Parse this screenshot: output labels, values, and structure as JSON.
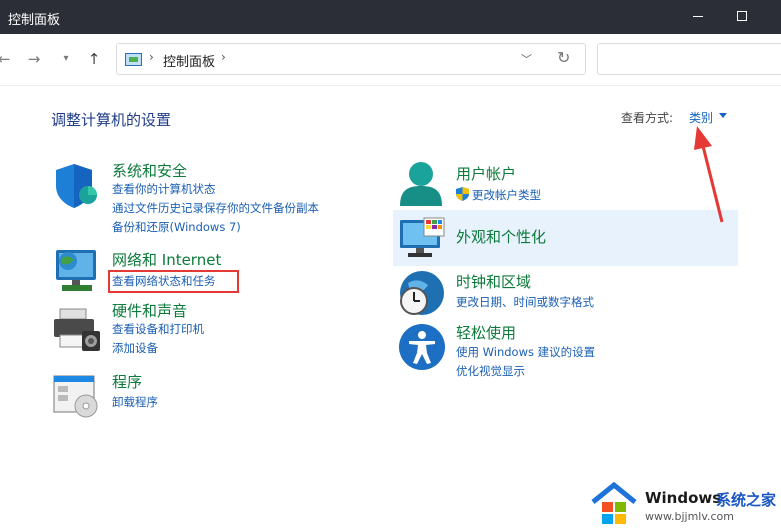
{
  "window": {
    "title": "控制面板"
  },
  "nav": {
    "breadcrumb": "控制面板"
  },
  "main": {
    "heading": "调整计算机的设置",
    "view_by_label": "查看方式:",
    "view_by_value": "类别"
  },
  "categories": {
    "security": {
      "title": "系统和安全",
      "links": [
        "查看你的计算机状态",
        "通过文件历史记录保存你的文件备份副本",
        "备份和还原(Windows 7)"
      ]
    },
    "network": {
      "title": "网络和 Internet",
      "links": [
        "查看网络状态和任务"
      ]
    },
    "hardware": {
      "title": "硬件和声音",
      "links": [
        "查看设备和打印机",
        "添加设备"
      ]
    },
    "programs": {
      "title": "程序",
      "links": [
        "卸载程序"
      ]
    },
    "users": {
      "title": "用户帐户",
      "links": [
        "更改帐户类型"
      ]
    },
    "appearance": {
      "title": "外观和个性化"
    },
    "clock": {
      "title": "时钟和区域",
      "links": [
        "更改日期、时间或数字格式"
      ]
    },
    "ease": {
      "title": "轻松使用",
      "links": [
        "使用 Windows 建议的设置",
        "优化视觉显示"
      ]
    }
  },
  "watermark": {
    "brand": "Windows",
    "brand_suffix": "系统之家",
    "url": "www.bjjmlv.com"
  },
  "colors": {
    "titlebar": "#2b2e36",
    "category_title": "#0b7a3a",
    "link": "#1a5fb4",
    "annotation": "#e53935",
    "highlight": "#e8f2fc"
  }
}
